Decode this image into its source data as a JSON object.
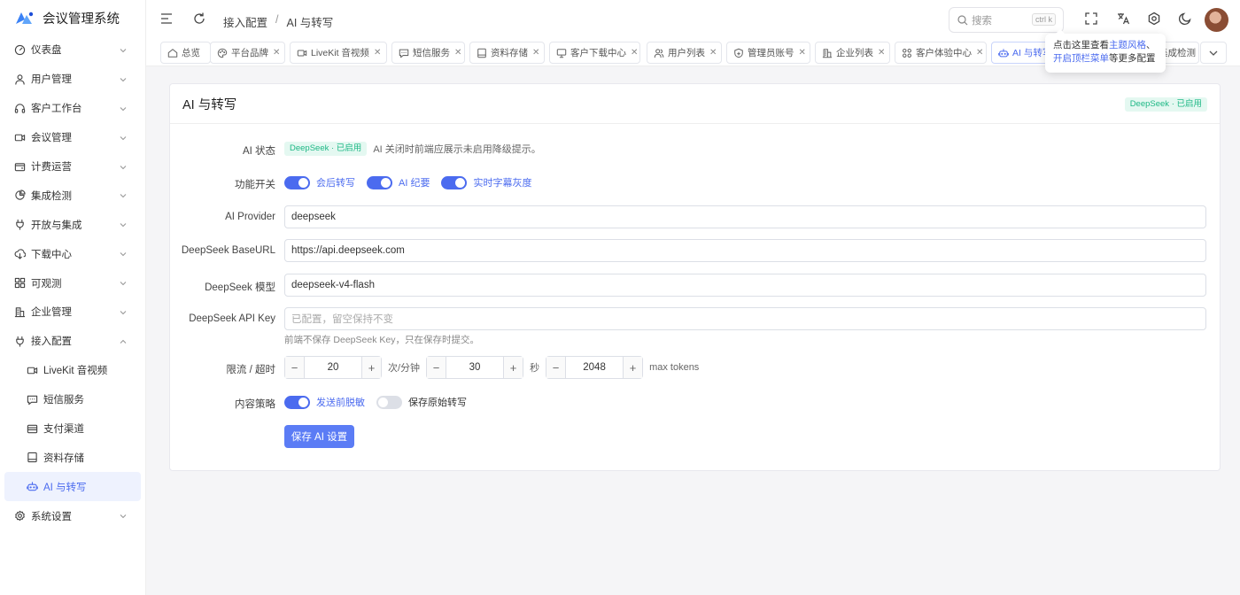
{
  "app": {
    "title": "会议管理系统"
  },
  "sidebar": {
    "items": [
      {
        "label": "仪表盘",
        "icon": "dashboard-icon"
      },
      {
        "label": "用户管理",
        "icon": "user-icon"
      },
      {
        "label": "客户工作台",
        "icon": "headset-icon"
      },
      {
        "label": "会议管理",
        "icon": "video-icon"
      },
      {
        "label": "计费运营",
        "icon": "wallet-icon"
      },
      {
        "label": "集成检测",
        "icon": "chart-pie-icon"
      },
      {
        "label": "开放与集成",
        "icon": "plug-icon"
      },
      {
        "label": "下载中心",
        "icon": "cloud-download-icon"
      },
      {
        "label": "可观测",
        "icon": "grid-icon"
      },
      {
        "label": "企业管理",
        "icon": "building-icon"
      },
      {
        "label": "接入配置",
        "icon": "plug-icon"
      }
    ],
    "subitems": [
      {
        "label": "LiveKit 音视频",
        "icon": "video-icon"
      },
      {
        "label": "短信服务",
        "icon": "message-icon"
      },
      {
        "label": "支付渠道",
        "icon": "card-icon"
      },
      {
        "label": "资料存储",
        "icon": "storage-icon"
      },
      {
        "label": "AI 与转写",
        "icon": "robot-icon"
      }
    ],
    "last": {
      "label": "系统设置",
      "icon": "settings-icon"
    }
  },
  "header": {
    "breadcrumb": [
      "接入配置",
      "AI 与转写"
    ],
    "search_placeholder": "搜索",
    "search_shortcut": "ctrl k"
  },
  "tabs": [
    {
      "label": "总览",
      "closable": false
    },
    {
      "label": "平台品牌",
      "closable": true
    },
    {
      "label": "LiveKit 音视频",
      "closable": true
    },
    {
      "label": "短信服务",
      "closable": true
    },
    {
      "label": "资料存储",
      "closable": true
    },
    {
      "label": "客户下载中心",
      "closable": true
    },
    {
      "label": "用户列表",
      "closable": true
    },
    {
      "label": "管理员账号",
      "closable": true
    },
    {
      "label": "企业列表",
      "closable": true
    },
    {
      "label": "客户体验中心",
      "closable": true
    },
    {
      "label": "AI 与转写",
      "closable": true
    },
    {
      "label": "集成检测",
      "closable": true
    }
  ],
  "tooltip": {
    "prefix": "点击这里查看",
    "link1": "主题风格",
    "mid": "、",
    "link2": "开启顶栏菜单",
    "suffix": "等更多配置"
  },
  "card": {
    "title": "AI 与转写",
    "status_tag": "DeepSeek · 已启用",
    "ai_status": {
      "label": "AI 状态",
      "tag": "DeepSeek · 已启用",
      "note": "AI 关闭时前端应展示未启用降级提示。"
    },
    "features": {
      "label": "功能开关",
      "switches": [
        {
          "label": "会后转写",
          "on": true
        },
        {
          "label": "AI 纪要",
          "on": true
        },
        {
          "label": "实时字幕灰度",
          "on": true
        }
      ]
    },
    "provider": {
      "label": "AI Provider",
      "value": "deepseek"
    },
    "base_url": {
      "label": "DeepSeek BaseURL",
      "value": "https://api.deepseek.com"
    },
    "model": {
      "label": "DeepSeek 模型",
      "value": "deepseek-v4-flash"
    },
    "api_key": {
      "label": "DeepSeek API Key",
      "placeholder": "已配置，留空保持不变",
      "hint": "前端不保存 DeepSeek Key，只在保存时提交。"
    },
    "limits": {
      "label": "限流 / 超时",
      "rate": "20",
      "rate_unit": "次/分钟",
      "timeout": "30",
      "timeout_unit": "秒",
      "tokens": "2048",
      "tokens_unit": "max tokens"
    },
    "policy": {
      "label": "内容策略",
      "switches": [
        {
          "label": "发送前脱敏",
          "on": true
        },
        {
          "label": "保存原始转写",
          "on": false
        }
      ]
    },
    "save_button": "保存 AI 设置"
  }
}
